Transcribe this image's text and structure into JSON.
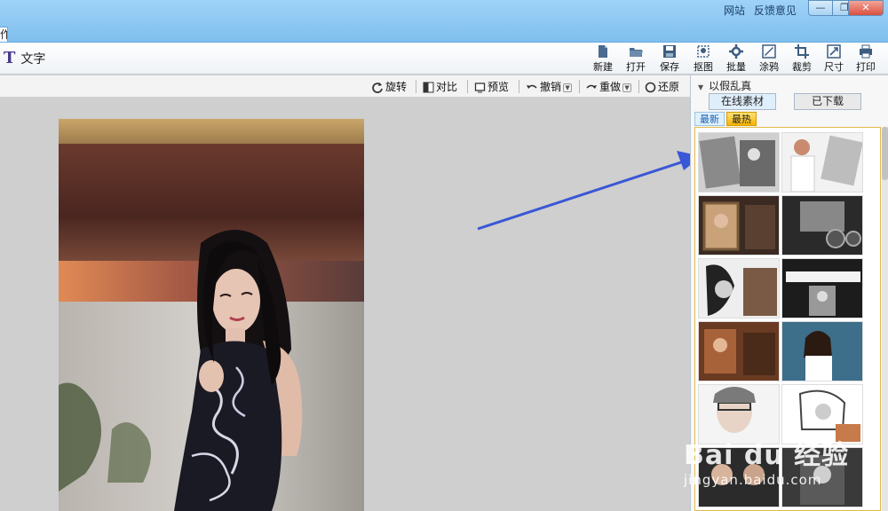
{
  "titlebar": {
    "links": [
      "网站",
      "反馈意见"
    ],
    "win_min": "—",
    "win_max": "❐",
    "win_close": "✕",
    "left_tab": "作"
  },
  "toolbar": {
    "text_tool": "文字",
    "text_icon": "T",
    "buttons": [
      {
        "label": "新建",
        "icon": "new-file-icon"
      },
      {
        "label": "打开",
        "icon": "open-folder-icon"
      },
      {
        "label": "保存",
        "icon": "save-disk-icon"
      },
      {
        "label": "抠图",
        "icon": "cutout-icon"
      },
      {
        "label": "批量",
        "icon": "batch-icon"
      },
      {
        "label": "涂鸦",
        "icon": "doodle-icon"
      },
      {
        "label": "裁剪",
        "icon": "crop-icon"
      },
      {
        "label": "尺寸",
        "icon": "resize-icon"
      },
      {
        "label": "打印",
        "icon": "printer-icon"
      }
    ]
  },
  "canvas_bar": {
    "rotate": "旋转",
    "compare": "对比",
    "preview": "预览",
    "undo": "撤销",
    "redo": "重做",
    "restore": "还原"
  },
  "panel": {
    "title": "以假乱真",
    "tabs": [
      "在线素材",
      "已下载"
    ],
    "subtabs": [
      "最新",
      "最热"
    ],
    "active_subtab": "最热"
  },
  "watermark": {
    "main": "Bai du 经验",
    "sub": "jingyan.baidu.com"
  },
  "colors": {
    "titlebar": "#8cc8f2",
    "accent_arrow": "#3a57d6",
    "hot_tab": "#f5b400"
  }
}
